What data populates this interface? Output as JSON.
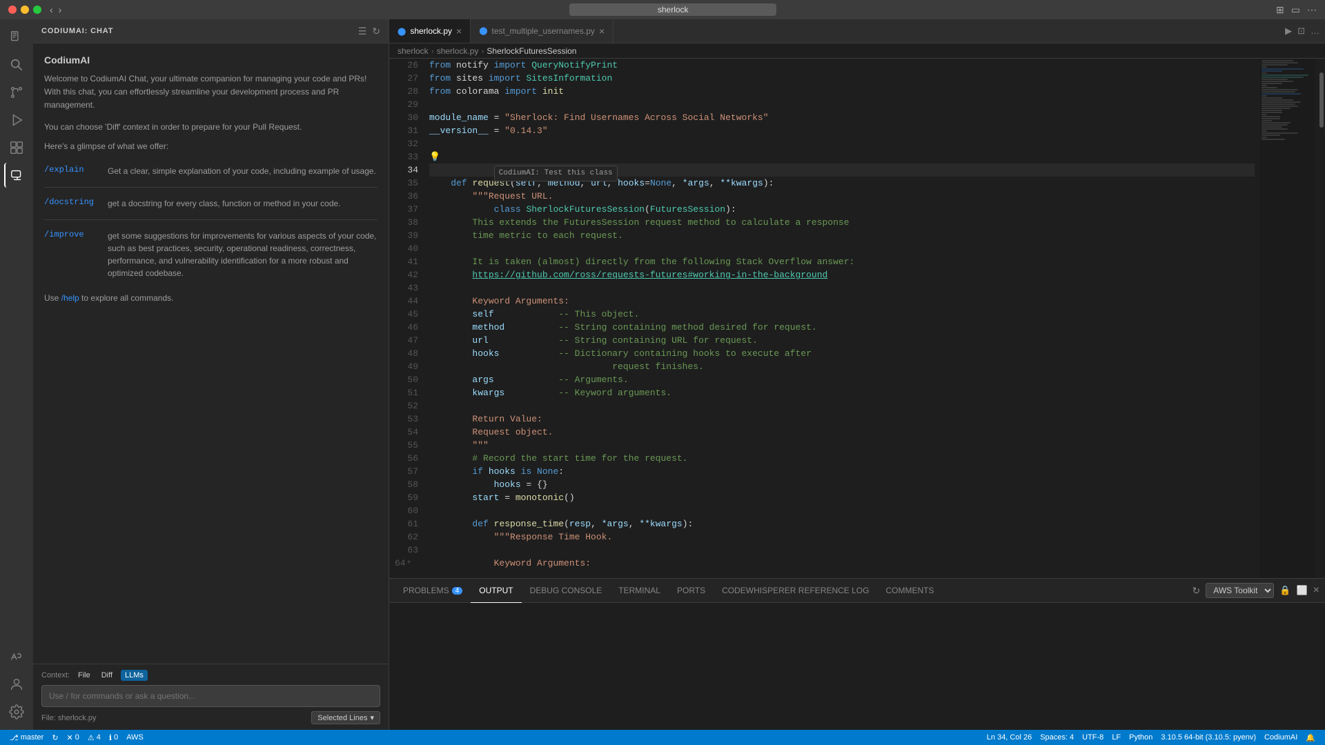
{
  "titlebar": {
    "search_placeholder": "sherlock",
    "nav_back": "‹",
    "nav_forward": "›"
  },
  "activity_bar": {
    "icons": [
      "explorer",
      "search",
      "source-control",
      "run-debug",
      "extensions",
      "codiumai",
      "aws"
    ]
  },
  "left_panel": {
    "title": "CODIUMAI: CHAT",
    "header_name": "CodiumAI",
    "welcome_text": "Welcome to CodiumAI Chat, your ultimate companion for managing your code and PRs! With this chat, you can effortlessly streamline your development process and PR management.",
    "choose_text": "You can choose 'Diff' context in order to prepare for your Pull Request.",
    "glimpse_text": "Here's a glimpse of what we offer:",
    "commands": [
      {
        "name": "/explain",
        "desc": "Get a clear, simple explanation of your code, including example of usage."
      },
      {
        "name": "/docstring",
        "desc": "get a docstring for every class, function or method in your code."
      },
      {
        "name": "/improve",
        "desc": "get some suggestions for improvements for various aspects of your code, such as best practices, security, operational readiness, correctness, performance, and vulnerability identification for a more robust and optimized codebase."
      }
    ],
    "help_text": "Use /help to explore all commands.",
    "input_placeholder": "Use / for commands or ask a question...",
    "context_label": "Context:",
    "file_btn": "File",
    "diff_btn": "Diff",
    "llms_btn": "LLMs",
    "file_label": "File: sherlock.py",
    "selected_lines_btn": "Selected Lines"
  },
  "editor": {
    "tabs": [
      {
        "name": "sherlock.py",
        "active": true,
        "modified": false
      },
      {
        "name": "test_multiple_usernames.py",
        "active": false,
        "modified": false
      }
    ],
    "breadcrumb": [
      "sherlock",
      "sherlock.py",
      "SherlockFuturesSession"
    ],
    "lines": [
      {
        "num": 26,
        "tokens": [
          {
            "t": "from ",
            "c": "kw"
          },
          {
            "t": "notify ",
            "c": ""
          },
          {
            "t": "import ",
            "c": "kw"
          },
          {
            "t": "QueryNotifyPrint",
            "c": "cls"
          }
        ]
      },
      {
        "num": 27,
        "tokens": [
          {
            "t": "from ",
            "c": "kw"
          },
          {
            "t": "sites ",
            "c": ""
          },
          {
            "t": "import ",
            "c": "kw"
          },
          {
            "t": "SitesInformation",
            "c": "cls"
          }
        ]
      },
      {
        "num": 28,
        "tokens": [
          {
            "t": "from ",
            "c": "kw"
          },
          {
            "t": "colorama ",
            "c": ""
          },
          {
            "t": "import ",
            "c": "kw"
          },
          {
            "t": "init",
            "c": "fn"
          }
        ]
      },
      {
        "num": 29,
        "tokens": [
          {
            "t": "",
            "c": ""
          }
        ]
      },
      {
        "num": 30,
        "tokens": [
          {
            "t": "module_name ",
            "c": "param"
          },
          {
            "t": "= ",
            "c": "op"
          },
          {
            "t": "\"Sherlock: Find Usernames Across Social Networks\"",
            "c": "str"
          }
        ]
      },
      {
        "num": 31,
        "tokens": [
          {
            "t": "__version__ ",
            "c": "param"
          },
          {
            "t": "= ",
            "c": "op"
          },
          {
            "t": "\"0.14.3\"",
            "c": "str"
          }
        ]
      },
      {
        "num": 32,
        "tokens": [
          {
            "t": "",
            "c": ""
          }
        ]
      },
      {
        "num": 33,
        "tokens": [
          {
            "t": "💡",
            "c": "bulb"
          }
        ]
      },
      {
        "num": 34,
        "tokens": [
          {
            "t": "class ",
            "c": "kw"
          },
          {
            "t": "SherlockFuturesSession",
            "c": "cls"
          },
          {
            "t": "(",
            "c": ""
          },
          {
            "t": "FuturesSession",
            "c": "cls"
          },
          {
            "t": "):",
            "c": ""
          }
        ],
        "current": true,
        "hint": "CodiumAI: Test this class"
      },
      {
        "num": 35,
        "tokens": [
          {
            "t": "    ",
            "c": ""
          },
          {
            "t": "def ",
            "c": "kw"
          },
          {
            "t": "request",
            "c": "fn"
          },
          {
            "t": "(",
            "c": ""
          },
          {
            "t": "self",
            "c": "param"
          },
          {
            "t": ", ",
            "c": ""
          },
          {
            "t": "method",
            "c": "param"
          },
          {
            "t": ", ",
            "c": ""
          },
          {
            "t": "url",
            "c": "param"
          },
          {
            "t": ", ",
            "c": ""
          },
          {
            "t": "hooks",
            "c": "param"
          },
          {
            "t": "=",
            "c": "op"
          },
          {
            "t": "None",
            "c": "kw"
          },
          {
            "t": ", ",
            "c": ""
          },
          {
            "t": "*args",
            "c": "param"
          },
          {
            "t": ", ",
            "c": ""
          },
          {
            "t": "**kwargs",
            "c": "param"
          },
          {
            "t": "):",
            "c": ""
          }
        ]
      },
      {
        "num": 36,
        "tokens": [
          {
            "t": "        ",
            "c": ""
          },
          {
            "t": "\"\"\"Request URL.",
            "c": "str"
          }
        ]
      },
      {
        "num": 37,
        "tokens": [
          {
            "t": "",
            "c": ""
          }
        ]
      },
      {
        "num": 38,
        "tokens": [
          {
            "t": "        ",
            "c": ""
          },
          {
            "t": "This extends the FuturesSession request method to calculate a response",
            "c": "cmt"
          }
        ]
      },
      {
        "num": 39,
        "tokens": [
          {
            "t": "        ",
            "c": ""
          },
          {
            "t": "time metric to each request.",
            "c": "cmt"
          }
        ]
      },
      {
        "num": 40,
        "tokens": [
          {
            "t": "",
            "c": ""
          }
        ]
      },
      {
        "num": 41,
        "tokens": [
          {
            "t": "        ",
            "c": ""
          },
          {
            "t": "It is taken (almost) directly from the following Stack Overflow answer:",
            "c": "cmt"
          }
        ]
      },
      {
        "num": 42,
        "tokens": [
          {
            "t": "        ",
            "c": ""
          },
          {
            "t": "https://github.com/ross/requests-futures#working-in-the-background",
            "c": "link"
          }
        ]
      },
      {
        "num": 43,
        "tokens": [
          {
            "t": "",
            "c": ""
          }
        ]
      },
      {
        "num": 44,
        "tokens": [
          {
            "t": "        ",
            "c": ""
          },
          {
            "t": "Keyword Arguments:",
            "c": "str"
          }
        ]
      },
      {
        "num": 45,
        "tokens": [
          {
            "t": "        ",
            "c": ""
          },
          {
            "t": "self",
            "c": "param"
          },
          {
            "t": "            -- This object.",
            "c": "cmt"
          }
        ]
      },
      {
        "num": 46,
        "tokens": [
          {
            "t": "        ",
            "c": ""
          },
          {
            "t": "method",
            "c": "param"
          },
          {
            "t": "          -- String containing method desired for request.",
            "c": "cmt"
          }
        ]
      },
      {
        "num": 47,
        "tokens": [
          {
            "t": "        ",
            "c": ""
          },
          {
            "t": "url",
            "c": "param"
          },
          {
            "t": "             -- String containing URL for request.",
            "c": "cmt"
          }
        ]
      },
      {
        "num": 48,
        "tokens": [
          {
            "t": "        ",
            "c": ""
          },
          {
            "t": "hooks",
            "c": "param"
          },
          {
            "t": "           -- Dictionary containing hooks to execute after",
            "c": "cmt"
          }
        ]
      },
      {
        "num": 49,
        "tokens": [
          {
            "t": "        ",
            "c": ""
          },
          {
            "t": "                          request finishes.",
            "c": "cmt"
          }
        ]
      },
      {
        "num": 50,
        "tokens": [
          {
            "t": "        ",
            "c": ""
          },
          {
            "t": "args",
            "c": "param"
          },
          {
            "t": "            -- Arguments.",
            "c": "cmt"
          }
        ]
      },
      {
        "num": 51,
        "tokens": [
          {
            "t": "        ",
            "c": ""
          },
          {
            "t": "kwargs",
            "c": "param"
          },
          {
            "t": "          -- Keyword arguments.",
            "c": "cmt"
          }
        ]
      },
      {
        "num": 52,
        "tokens": [
          {
            "t": "",
            "c": ""
          }
        ]
      },
      {
        "num": 53,
        "tokens": [
          {
            "t": "        ",
            "c": ""
          },
          {
            "t": "Return Value:",
            "c": "str"
          }
        ]
      },
      {
        "num": 54,
        "tokens": [
          {
            "t": "        ",
            "c": ""
          },
          {
            "t": "Request object.",
            "c": "str"
          }
        ]
      },
      {
        "num": 55,
        "tokens": [
          {
            "t": "        ",
            "c": ""
          },
          {
            "t": "\"\"\"",
            "c": "str"
          }
        ]
      },
      {
        "num": 56,
        "tokens": [
          {
            "t": "        ",
            "c": ""
          },
          {
            "t": "# Record the start time for the request.",
            "c": "cmt"
          }
        ]
      },
      {
        "num": 57,
        "tokens": [
          {
            "t": "        ",
            "c": ""
          },
          {
            "t": "if ",
            "c": "kw"
          },
          {
            "t": "hooks ",
            "c": "param"
          },
          {
            "t": "is ",
            "c": "kw"
          },
          {
            "t": "None",
            "c": "kw"
          },
          {
            "t": ":",
            "c": ""
          }
        ]
      },
      {
        "num": 58,
        "tokens": [
          {
            "t": "            ",
            "c": ""
          },
          {
            "t": "hooks ",
            "c": "param"
          },
          {
            "t": "= {}",
            "c": ""
          }
        ]
      },
      {
        "num": 59,
        "tokens": [
          {
            "t": "        ",
            "c": ""
          },
          {
            "t": "start ",
            "c": "param"
          },
          {
            "t": "= ",
            "c": "op"
          },
          {
            "t": "monotonic",
            "c": "fn"
          },
          {
            "t": "()",
            "c": ""
          }
        ]
      },
      {
        "num": 60,
        "tokens": [
          {
            "t": "",
            "c": ""
          }
        ]
      },
      {
        "num": 61,
        "tokens": [
          {
            "t": "        ",
            "c": ""
          },
          {
            "t": "def ",
            "c": "kw"
          },
          {
            "t": "response_time",
            "c": "fn"
          },
          {
            "t": "(",
            "c": ""
          },
          {
            "t": "resp",
            "c": "param"
          },
          {
            "t": ", ",
            "c": ""
          },
          {
            "t": "*args",
            "c": "param"
          },
          {
            "t": ", ",
            "c": ""
          },
          {
            "t": "**kwargs",
            "c": "param"
          },
          {
            "t": "):",
            "c": ""
          }
        ]
      },
      {
        "num": 62,
        "tokens": [
          {
            "t": "            ",
            "c": ""
          },
          {
            "t": "\"\"\"Response Time Hook.",
            "c": "str"
          }
        ]
      },
      {
        "num": 63,
        "tokens": [
          {
            "t": "",
            "c": ""
          }
        ]
      },
      {
        "num": 64,
        "tokens": [
          {
            "t": "            ",
            "c": ""
          },
          {
            "t": "Keyword Arguments:",
            "c": "str"
          }
        ],
        "plus": true
      }
    ]
  },
  "panel": {
    "tabs": [
      "PROBLEMS",
      "OUTPUT",
      "DEBUG CONSOLE",
      "TERMINAL",
      "PORTS",
      "CODEWHISPERER REFERENCE LOG",
      "COMMENTS"
    ],
    "active_tab": "OUTPUT",
    "problems_badge": "4",
    "aws_toolkit_label": "AWS Toolkit"
  },
  "status_bar": {
    "branch": "master",
    "errors": "0",
    "warnings": "4",
    "info": "0",
    "aws_label": "AWS",
    "line_col": "Ln 34, Col 26",
    "spaces": "Spaces: 4",
    "encoding": "UTF-8",
    "line_ending": "LF",
    "language": "Python",
    "python_version": "3.10.5 64-bit (3.10.5: pyenv)",
    "codiumai": "CodiumAI",
    "bell": "🔔"
  }
}
